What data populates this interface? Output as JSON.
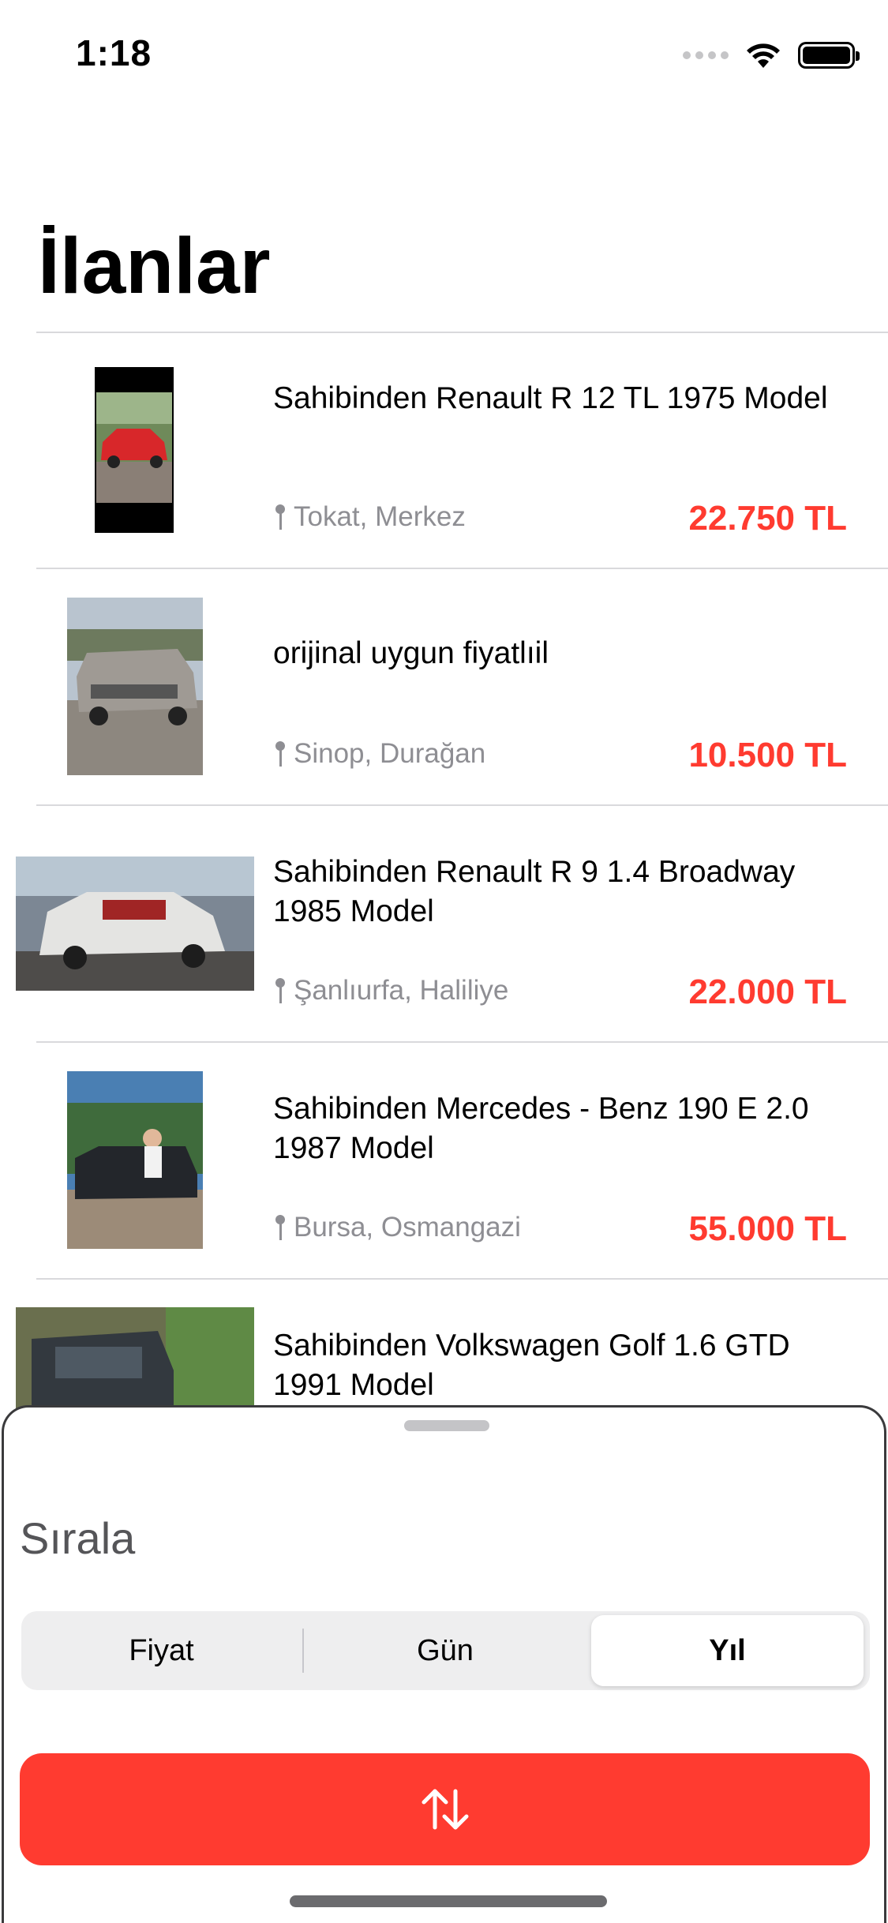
{
  "status_bar": {
    "time": "1:18",
    "icons": [
      "signal-icon",
      "wifi-icon",
      "battery-icon"
    ]
  },
  "header": {
    "title": "İlanlar"
  },
  "listings": [
    {
      "title": "Sahibinden Renault R 12 TL 1975 Model",
      "location": "Tokat, Merkez",
      "price": "22.750 TL"
    },
    {
      "title": "orijinal uygun fiyatlıil",
      "location": "Sinop, Durağan",
      "price": "10.500 TL"
    },
    {
      "title": "Sahibinden Renault R 9 1.4 Broadway 1985 Model",
      "location": "Şanlıurfa, Haliliye",
      "price": "22.000 TL"
    },
    {
      "title": "Sahibinden Mercedes - Benz 190 E 2.0 1987 Model",
      "location": "Bursa, Osmangazi",
      "price": "55.000 TL"
    },
    {
      "title": "Sahibinden Volkswagen Golf 1.6 GTD 1991 Model",
      "location": "",
      "price": ""
    }
  ],
  "sort_sheet": {
    "title": "Sırala",
    "segments": [
      "Fiyat",
      "Gün",
      "Yıl"
    ],
    "selected_segment": "Yıl",
    "button_icon": "sort-arrows-icon"
  },
  "colors": {
    "accent": "#ff3b30",
    "secondary_text": "#8e8e93",
    "separator": "#d9d9dc"
  }
}
